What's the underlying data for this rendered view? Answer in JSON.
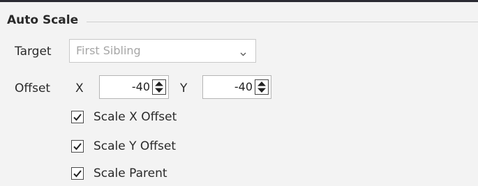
{
  "group": {
    "title": "Auto Scale"
  },
  "target": {
    "label": "Target",
    "selected": "First Sibling",
    "dropdown_icon": "chevron-down-icon"
  },
  "offset": {
    "label": "Offset",
    "x_label": "X",
    "x_value": "-40",
    "y_label": "Y",
    "y_value": "-40",
    "spinner_icon": "up-down-arrows-icon"
  },
  "checkboxes": [
    {
      "label": "Scale X Offset",
      "checked": true
    },
    {
      "label": "Scale Y Offset",
      "checked": true
    },
    {
      "label": "Scale Parent",
      "checked": true
    }
  ]
}
